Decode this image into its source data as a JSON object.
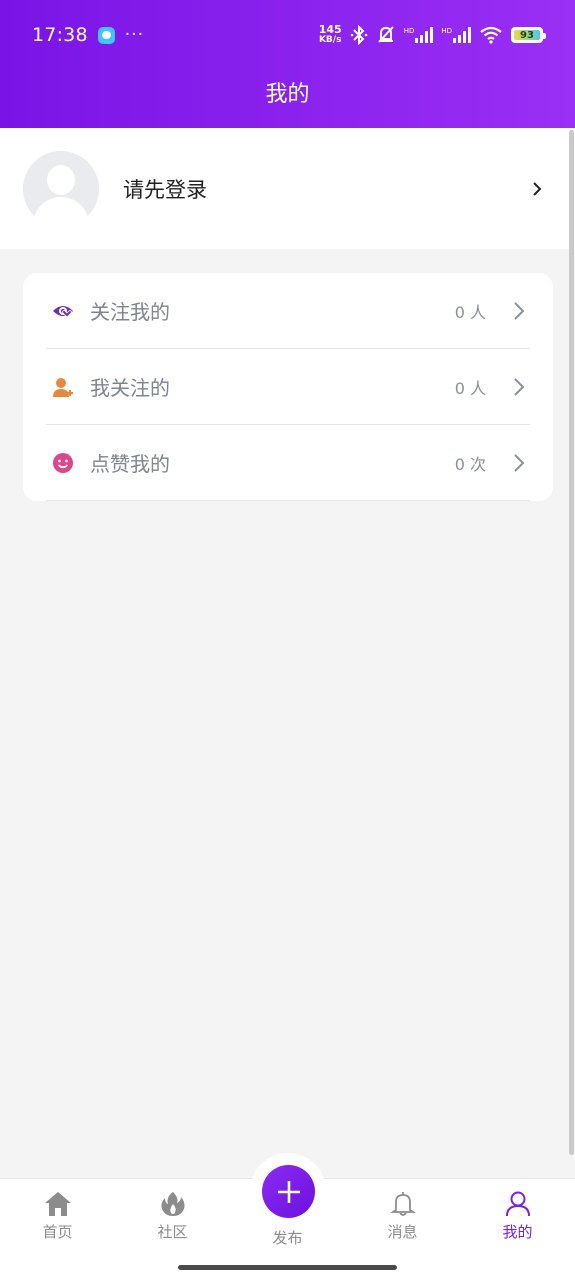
{
  "status_bar": {
    "time": "17:38",
    "more": "···",
    "net_speed_value": "145",
    "net_speed_unit": "KB/s",
    "hd1": "HD",
    "hd2": "HD",
    "battery": "93"
  },
  "header": {
    "title": "我的"
  },
  "profile": {
    "login_prompt": "请先登录"
  },
  "menu": {
    "items": [
      {
        "label": "关注我的",
        "count": "0 人",
        "icon": "eye-heart-icon",
        "icon_color": "#6b2fc0"
      },
      {
        "label": "我关注的",
        "count": "0 人",
        "icon": "user-add-icon",
        "icon_color": "#e8883a"
      },
      {
        "label": "点赞我的",
        "count": "0 次",
        "icon": "smile-icon",
        "icon_color": "#e0458a"
      }
    ]
  },
  "tabbar": {
    "items": [
      {
        "label": "首页",
        "icon": "home-icon"
      },
      {
        "label": "社区",
        "icon": "flame-icon"
      },
      {
        "label": "发布",
        "icon": "plus-icon"
      },
      {
        "label": "消息",
        "icon": "bell-icon"
      },
      {
        "label": "我的",
        "icon": "person-icon",
        "active": true
      }
    ]
  },
  "colors": {
    "accent": "#7a14e6",
    "background": "#f4f4f4",
    "card": "#ffffff"
  }
}
